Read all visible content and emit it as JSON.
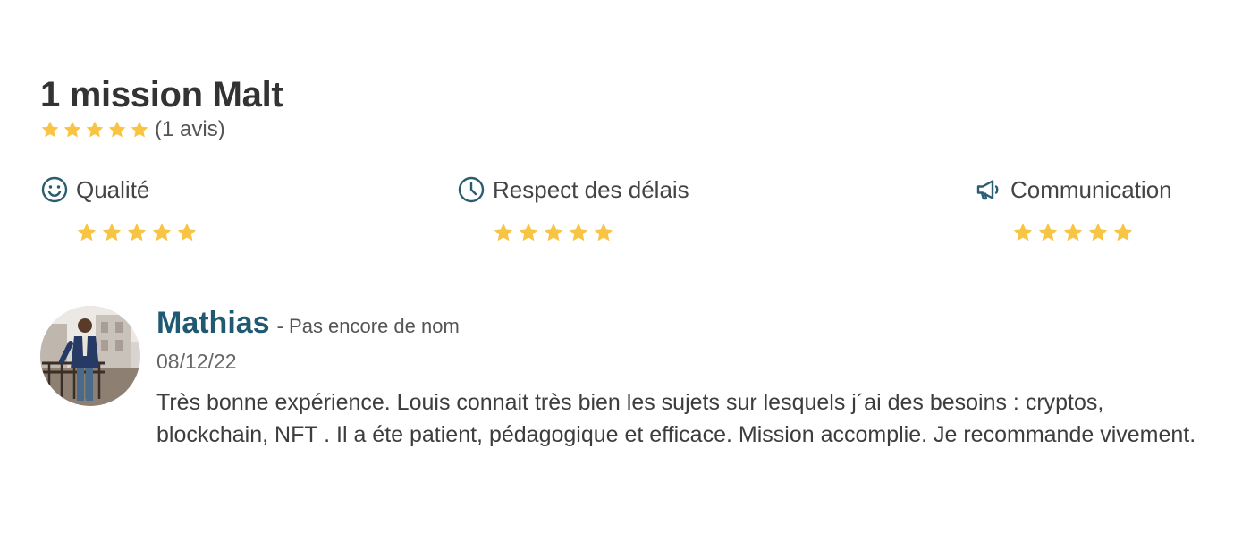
{
  "header": {
    "title": "1 mission Malt",
    "rating": 5,
    "rating_max": 5,
    "review_count_text": "(1 avis)"
  },
  "criteria": [
    {
      "label": "Qualité",
      "icon": "smiley-icon",
      "rating": 5
    },
    {
      "label": "Respect des délais",
      "icon": "clock-icon",
      "rating": 5
    },
    {
      "label": "Communication",
      "icon": "megaphone-icon",
      "rating": 5
    }
  ],
  "review": {
    "author": "Mathias",
    "company": "- Pas encore de nom",
    "date": "08/12/22",
    "text": "Très bonne expérience. Louis connait très bien les sujets sur lesquels j´ai des besoins : cryptos, blockchain, NFT . Il a éte patient, pédagogique et efficace. Mission accomplie. Je recommande vivement."
  },
  "colors": {
    "star": "#f7c443",
    "icon": "#2a5d70",
    "author": "#1f5a72",
    "title": "#333333"
  }
}
